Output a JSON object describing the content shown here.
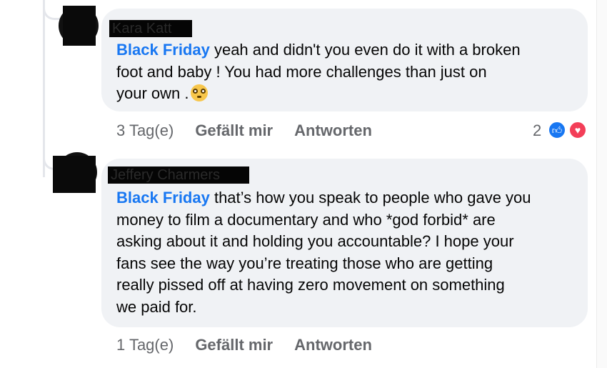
{
  "comments": [
    {
      "author": "Kara Katt",
      "mention": "Black Friday",
      "text_lines": [
        " yeah and didn't you even do it with a broken",
        "foot and baby ! You had more challenges than just on",
        "your own ."
      ],
      "emoji": "flushed-face",
      "timestamp": "3 Tag(e)",
      "like_label": "Gefällt mir",
      "reply_label": "Antworten",
      "reaction_count": "2"
    },
    {
      "author": "Jeffery Charmers",
      "mention": "Black Friday",
      "text_lines": [
        " that’s how you speak to people who gave you",
        "money to film a documentary and who *god forbid* are",
        "asking about it and holding you accountable? I hope your",
        "fans see the way you’re treating those who are getting",
        "really pissed off at having zero movement on something",
        "we paid for."
      ],
      "timestamp": "1 Tag(e)",
      "like_label": "Gefällt mir",
      "reply_label": "Antworten"
    }
  ],
  "colors": {
    "mention": "#1877f2",
    "bubble": "#f0f2f5",
    "meta": "#65676b",
    "like": "#1877f2",
    "love": "#f33e58"
  }
}
